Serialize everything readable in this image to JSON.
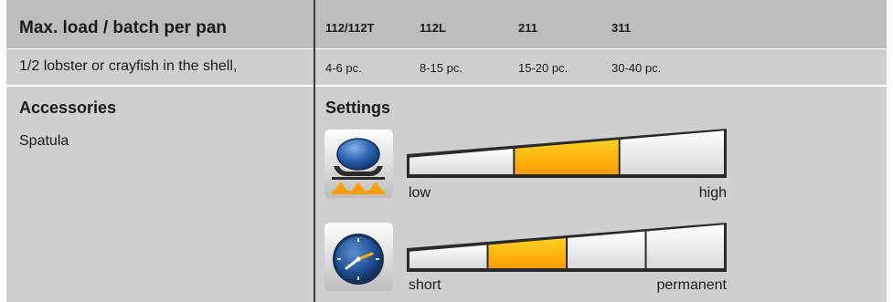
{
  "table": {
    "title": "Max. load / batch per pan",
    "columns": [
      "112/112T",
      "112L",
      "211",
      "311"
    ],
    "row": {
      "item": "1/2 lobster or crayfish in the shell,",
      "values": [
        "4-6 pc.",
        "8-15 pc.",
        "15-20 pc.",
        "30-40 pc."
      ]
    }
  },
  "accessories": {
    "heading": "Accessories",
    "items": [
      "Spatula"
    ]
  },
  "settings": {
    "heading": "Settings",
    "scales": [
      {
        "icon": "steam-power-icon",
        "label_min": "low",
        "label_max": "high",
        "segments": 3,
        "active_segment": 2
      },
      {
        "icon": "clock-icon",
        "label_min": "short",
        "label_max": "permanent",
        "segments": 4,
        "active_segment": 2
      }
    ]
  },
  "colors": {
    "active_segment_top": "#ffd21f",
    "active_segment_bottom": "#ff9c00",
    "panel": "#cfcfcf",
    "header": "#bdbdbd"
  }
}
